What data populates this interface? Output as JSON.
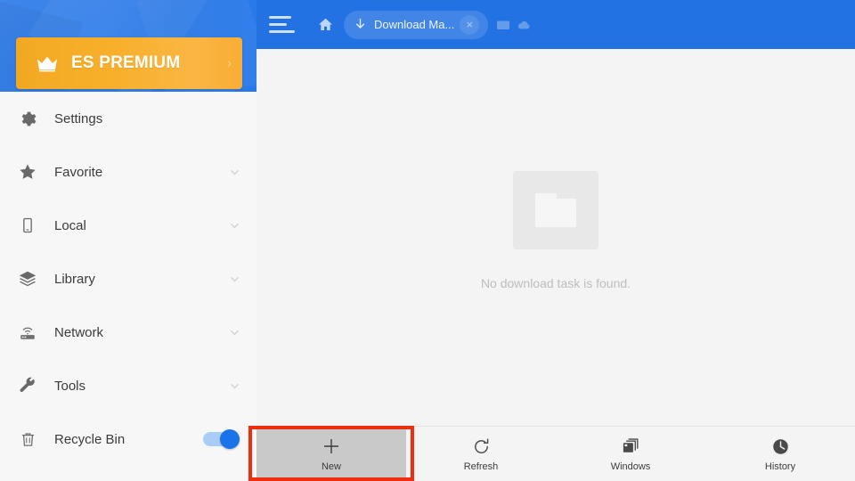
{
  "app": {
    "name": "ES File Explorer",
    "accent_blue": "#2272e3",
    "premium_orange": "#f7ad2b",
    "annotation_color": "#ef2d0f"
  },
  "sidebar": {
    "premium": {
      "label": "ES PREMIUM",
      "icon": "crown-icon",
      "chevron": "›"
    },
    "items": [
      {
        "label": "Settings",
        "icon": "gear-icon",
        "chevron": false,
        "toggle": false
      },
      {
        "label": "Favorite",
        "icon": "star-icon",
        "chevron": true,
        "toggle": false
      },
      {
        "label": "Local",
        "icon": "phone-icon",
        "chevron": true,
        "toggle": false
      },
      {
        "label": "Library",
        "icon": "layers-icon",
        "chevron": true,
        "toggle": false
      },
      {
        "label": "Network",
        "icon": "router-icon",
        "chevron": true,
        "toggle": false
      },
      {
        "label": "Tools",
        "icon": "wrench-icon",
        "chevron": true,
        "toggle": false
      },
      {
        "label": "Recycle Bin",
        "icon": "trash-icon",
        "chevron": false,
        "toggle": true,
        "toggle_state": "on"
      }
    ]
  },
  "header": {
    "menu_icon": "hamburger-menu-icon",
    "home_icon": "home-icon",
    "tab": {
      "icon": "download-arrow-icon",
      "title": "Download Ma...",
      "close": "×"
    },
    "extra_icons": [
      {
        "name": "window-icon"
      },
      {
        "name": "cloud-icon"
      }
    ]
  },
  "main": {
    "empty_state": {
      "icon": "folder-icon",
      "message": "No download task is found."
    }
  },
  "toolbar": {
    "buttons": [
      {
        "label": "New",
        "icon": "plus-icon",
        "active": true
      },
      {
        "label": "Refresh",
        "icon": "refresh-icon",
        "active": false
      },
      {
        "label": "Windows",
        "icon": "windows-icon",
        "active": false
      },
      {
        "label": "History",
        "icon": "clock-icon",
        "active": false
      }
    ]
  }
}
